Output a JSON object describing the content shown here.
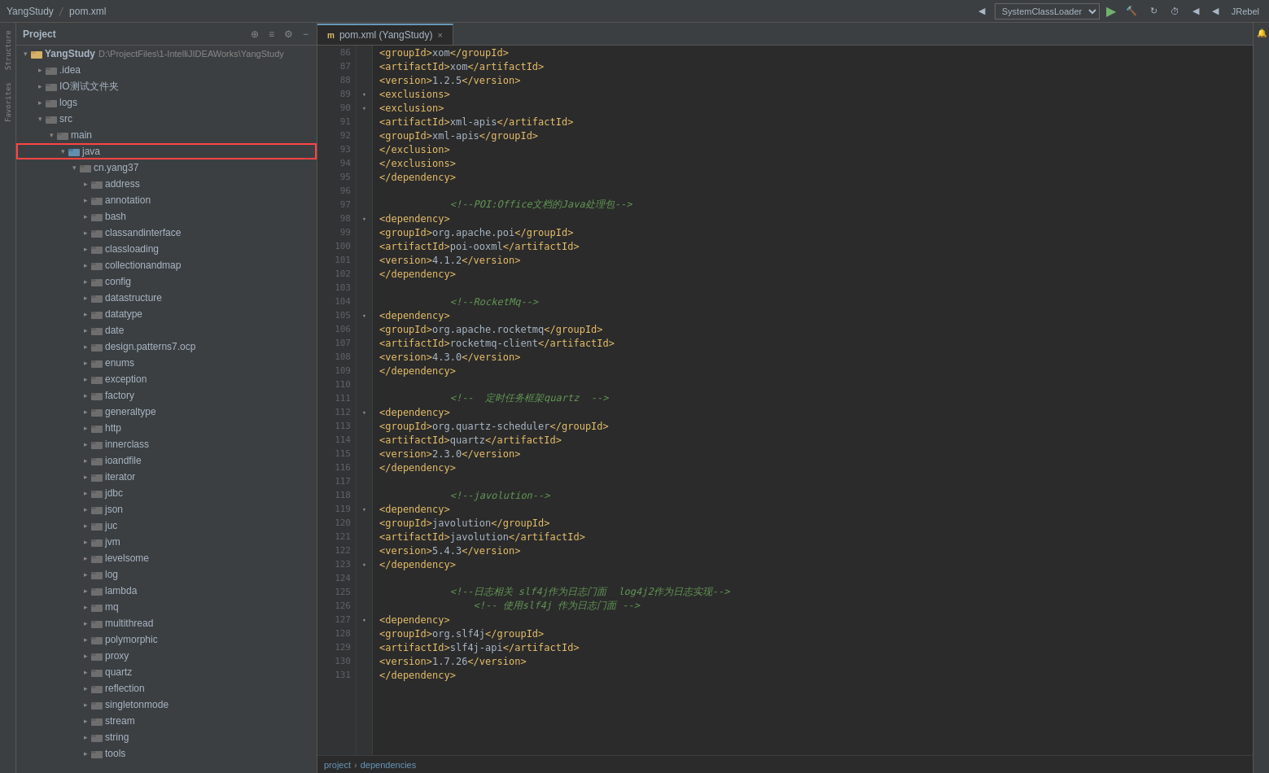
{
  "app": {
    "name": "YangStudy",
    "file": "pom.xml"
  },
  "toolbar": {
    "run_config": "SystemClassLoader",
    "jrebel": "JRebel"
  },
  "project_panel": {
    "title": "Project",
    "root": {
      "name": "YangStudy",
      "path": "D:\\ProjectFiles\\1-IntelliJIDEAWorks\\YangStudy"
    },
    "items": [
      {
        "id": "idea",
        "label": ".idea",
        "level": 1,
        "type": "folder",
        "expanded": false
      },
      {
        "id": "io-test",
        "label": "IO测试文件夹",
        "level": 1,
        "type": "folder",
        "expanded": false
      },
      {
        "id": "logs",
        "label": "logs",
        "level": 1,
        "type": "folder",
        "expanded": false
      },
      {
        "id": "src",
        "label": "src",
        "level": 1,
        "type": "folder",
        "expanded": true
      },
      {
        "id": "main",
        "label": "main",
        "level": 2,
        "type": "folder",
        "expanded": true
      },
      {
        "id": "java",
        "label": "java",
        "level": 3,
        "type": "folder",
        "expanded": true,
        "highlighted": true
      },
      {
        "id": "cn-yang37",
        "label": "cn.yang37",
        "level": 4,
        "type": "folder",
        "expanded": true
      },
      {
        "id": "address",
        "label": "address",
        "level": 5,
        "type": "folder",
        "expanded": false
      },
      {
        "id": "annotation",
        "label": "annotation",
        "level": 5,
        "type": "folder",
        "expanded": false
      },
      {
        "id": "bash",
        "label": "bash",
        "level": 5,
        "type": "folder",
        "expanded": false
      },
      {
        "id": "classandinterface",
        "label": "classandinterface",
        "level": 5,
        "type": "folder",
        "expanded": false
      },
      {
        "id": "classloading",
        "label": "classloading",
        "level": 5,
        "type": "folder",
        "expanded": false
      },
      {
        "id": "collectionandmap",
        "label": "collectionandmap",
        "level": 5,
        "type": "folder",
        "expanded": false
      },
      {
        "id": "config",
        "label": "config",
        "level": 5,
        "type": "folder",
        "expanded": false
      },
      {
        "id": "datastructure",
        "label": "datastructure",
        "level": 5,
        "type": "folder",
        "expanded": false
      },
      {
        "id": "datatype",
        "label": "datatype",
        "level": 5,
        "type": "folder",
        "expanded": false
      },
      {
        "id": "date",
        "label": "date",
        "level": 5,
        "type": "folder",
        "expanded": false
      },
      {
        "id": "design-patterns",
        "label": "design.patterns7.ocp",
        "level": 5,
        "type": "folder",
        "expanded": false
      },
      {
        "id": "enums",
        "label": "enums",
        "level": 5,
        "type": "folder",
        "expanded": false
      },
      {
        "id": "exception",
        "label": "exception",
        "level": 5,
        "type": "folder",
        "expanded": false
      },
      {
        "id": "factory",
        "label": "factory",
        "level": 5,
        "type": "folder",
        "expanded": false
      },
      {
        "id": "generaltype",
        "label": "generaltype",
        "level": 5,
        "type": "folder",
        "expanded": false
      },
      {
        "id": "http",
        "label": "http",
        "level": 5,
        "type": "folder",
        "expanded": false
      },
      {
        "id": "innerclass",
        "label": "innerclass",
        "level": 5,
        "type": "folder",
        "expanded": false
      },
      {
        "id": "ioandfile",
        "label": "ioandfile",
        "level": 5,
        "type": "folder",
        "expanded": false
      },
      {
        "id": "iterator",
        "label": "iterator",
        "level": 5,
        "type": "folder",
        "expanded": false
      },
      {
        "id": "jdbc",
        "label": "jdbc",
        "level": 5,
        "type": "folder",
        "expanded": false
      },
      {
        "id": "json",
        "label": "json",
        "level": 5,
        "type": "folder",
        "expanded": false
      },
      {
        "id": "juc",
        "label": "juc",
        "level": 5,
        "type": "folder",
        "expanded": false
      },
      {
        "id": "jvm",
        "label": "jvm",
        "level": 5,
        "type": "folder",
        "expanded": false
      },
      {
        "id": "levelsome",
        "label": "levelsome",
        "level": 5,
        "type": "folder",
        "expanded": false
      },
      {
        "id": "log",
        "label": "log",
        "level": 5,
        "type": "folder",
        "expanded": false
      },
      {
        "id": "lambda",
        "label": "lambda",
        "level": 5,
        "type": "folder",
        "expanded": false
      },
      {
        "id": "mq",
        "label": "mq",
        "level": 5,
        "type": "folder",
        "expanded": false
      },
      {
        "id": "multithread",
        "label": "multithread",
        "level": 5,
        "type": "folder",
        "expanded": false
      },
      {
        "id": "polymorphic",
        "label": "polymorphic",
        "level": 5,
        "type": "folder",
        "expanded": false
      },
      {
        "id": "proxy",
        "label": "proxy",
        "level": 5,
        "type": "folder",
        "expanded": false
      },
      {
        "id": "quartz",
        "label": "quartz",
        "level": 5,
        "type": "folder",
        "expanded": false
      },
      {
        "id": "reflection",
        "label": "reflection",
        "level": 5,
        "type": "folder",
        "expanded": false
      },
      {
        "id": "singletonmode",
        "label": "singletonmode",
        "level": 5,
        "type": "folder",
        "expanded": false
      },
      {
        "id": "stream",
        "label": "stream",
        "level": 5,
        "type": "folder",
        "expanded": false
      },
      {
        "id": "string",
        "label": "string",
        "level": 5,
        "type": "folder",
        "expanded": false
      },
      {
        "id": "tools",
        "label": "tools",
        "level": 5,
        "type": "folder",
        "expanded": false
      }
    ]
  },
  "editor": {
    "tab_label": "pom.xml",
    "tab_app": "YangStudy"
  },
  "code_lines": [
    {
      "num": 86,
      "indent": 4,
      "content": "<groupId>xom</groupId>",
      "type": "xml"
    },
    {
      "num": 87,
      "indent": 4,
      "content": "<artifactId>xom</artifactId>",
      "type": "xml"
    },
    {
      "num": 88,
      "indent": 4,
      "content": "<version>1.2.5</version>",
      "type": "xml"
    },
    {
      "num": 89,
      "indent": 4,
      "content": "<exclusions>",
      "type": "xml",
      "fold": true
    },
    {
      "num": 90,
      "indent": 5,
      "content": "<exclusion>",
      "type": "xml",
      "fold": true
    },
    {
      "num": 91,
      "indent": 6,
      "content": "<artifactId>xml-apis</artifactId>",
      "type": "xml"
    },
    {
      "num": 92,
      "indent": 6,
      "content": "<groupId>xml-apis</groupId>",
      "type": "xml"
    },
    {
      "num": 93,
      "indent": 5,
      "content": "</exclusion>",
      "type": "xml"
    },
    {
      "num": 94,
      "indent": 4,
      "content": "</exclusions>",
      "type": "xml"
    },
    {
      "num": 95,
      "indent": 3,
      "content": "</dependency>",
      "type": "xml"
    },
    {
      "num": 96,
      "indent": 0,
      "content": "",
      "type": "empty"
    },
    {
      "num": 97,
      "indent": 3,
      "content": "<!--POI:Office文档的Java处理包-->",
      "type": "comment"
    },
    {
      "num": 98,
      "indent": 3,
      "content": "<dependency>",
      "type": "xml",
      "fold": true
    },
    {
      "num": 99,
      "indent": 4,
      "content": "<groupId>org.apache.poi</groupId>",
      "type": "xml"
    },
    {
      "num": 100,
      "indent": 4,
      "content": "<artifactId>poi-ooxml</artifactId>",
      "type": "xml"
    },
    {
      "num": 101,
      "indent": 4,
      "content": "<version>4.1.2</version>",
      "type": "xml"
    },
    {
      "num": 102,
      "indent": 3,
      "content": "</dependency>",
      "type": "xml"
    },
    {
      "num": 103,
      "indent": 0,
      "content": "",
      "type": "empty"
    },
    {
      "num": 104,
      "indent": 3,
      "content": "<!--RocketMq-->",
      "type": "comment"
    },
    {
      "num": 105,
      "indent": 3,
      "content": "<dependency>",
      "type": "xml",
      "fold": true
    },
    {
      "num": 106,
      "indent": 4,
      "content": "<groupId>org.apache.rocketmq</groupId>",
      "type": "xml"
    },
    {
      "num": 107,
      "indent": 4,
      "content": "<artifactId>rocketmq-client</artifactId>",
      "type": "xml"
    },
    {
      "num": 108,
      "indent": 4,
      "content": "<version>4.3.0</version>",
      "type": "xml"
    },
    {
      "num": 109,
      "indent": 3,
      "content": "</dependency>",
      "type": "xml"
    },
    {
      "num": 110,
      "indent": 0,
      "content": "",
      "type": "empty"
    },
    {
      "num": 111,
      "indent": 3,
      "content": "<!--  定时任务框架quartz  -->",
      "type": "comment"
    },
    {
      "num": 112,
      "indent": 3,
      "content": "<dependency>",
      "type": "xml",
      "fold": true
    },
    {
      "num": 113,
      "indent": 4,
      "content": "<groupId>org.quartz-scheduler</groupId>",
      "type": "xml"
    },
    {
      "num": 114,
      "indent": 4,
      "content": "<artifactId>quartz</artifactId>",
      "type": "xml"
    },
    {
      "num": 115,
      "indent": 4,
      "content": "<version>2.3.0</version>",
      "type": "xml"
    },
    {
      "num": 116,
      "indent": 3,
      "content": "</dependency>",
      "type": "xml"
    },
    {
      "num": 117,
      "indent": 0,
      "content": "",
      "type": "empty"
    },
    {
      "num": 118,
      "indent": 3,
      "content": "<!--javolution-->",
      "type": "comment"
    },
    {
      "num": 119,
      "indent": 3,
      "content": "<dependency>",
      "type": "xml",
      "fold": true
    },
    {
      "num": 120,
      "indent": 4,
      "content": "<groupId>javolution</groupId>",
      "type": "xml"
    },
    {
      "num": 121,
      "indent": 4,
      "content": "<artifactId>javolution</artifactId>",
      "type": "xml"
    },
    {
      "num": 122,
      "indent": 4,
      "content": "<version>5.4.3</version>",
      "type": "xml"
    },
    {
      "num": 123,
      "indent": 3,
      "content": "</dependency>",
      "type": "xml"
    },
    {
      "num": 124,
      "indent": 0,
      "content": "",
      "type": "empty"
    },
    {
      "num": 125,
      "indent": 3,
      "content": "<!--日志相关 slf4j作为日志门面  log4j2作为日志实现-->",
      "type": "comment"
    },
    {
      "num": 126,
      "indent": 4,
      "content": "<!-- 使用slf4j 作为日志门面 -->",
      "type": "comment"
    },
    {
      "num": 127,
      "indent": 3,
      "content": "<dependency>",
      "type": "xml",
      "fold": true
    },
    {
      "num": 128,
      "indent": 4,
      "content": "<groupId>org.slf4j</groupId>",
      "type": "xml"
    },
    {
      "num": 129,
      "indent": 4,
      "content": "<artifactId>slf4j-api</artifactId>",
      "type": "xml"
    },
    {
      "num": 130,
      "indent": 4,
      "content": "<version>1.7.26</version>",
      "type": "xml"
    },
    {
      "num": 131,
      "indent": 3,
      "content": "</dependency>",
      "type": "xml"
    }
  ],
  "breadcrumb": {
    "items": [
      "project",
      "dependencies"
    ]
  },
  "colors": {
    "tag": "#e8bf6a",
    "comment": "#629755",
    "groupid": "#6897bb",
    "accent": "#6897bb",
    "selected": "#0d47a1",
    "highlight_border": "#ff4444"
  }
}
